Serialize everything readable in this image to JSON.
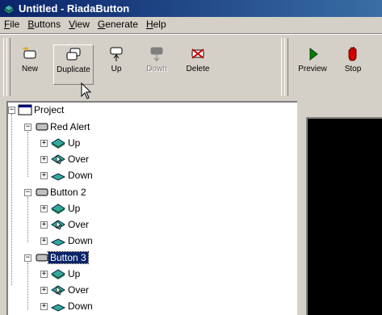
{
  "window": {
    "title": "Untitled - RiadaButton"
  },
  "menu": [
    {
      "label": "File",
      "u": "F"
    },
    {
      "label": "Buttons",
      "u": "B"
    },
    {
      "label": "View",
      "u": "V"
    },
    {
      "label": "Generate",
      "u": "G"
    },
    {
      "label": "Help",
      "u": "H"
    }
  ],
  "toolbar": {
    "new_label": "New",
    "duplicate_label": "Duplicate",
    "up_label": "Up",
    "down_label": "Down",
    "delete_label": "Delete",
    "preview_label": "Preview",
    "stop_label": "Stop"
  },
  "tree": {
    "root": "Project",
    "buttons": [
      {
        "name": "Red Alert",
        "states": [
          "Up",
          "Over",
          "Down"
        ],
        "selected": false
      },
      {
        "name": "Button 2",
        "states": [
          "Up",
          "Over",
          "Down"
        ],
        "selected": false
      },
      {
        "name": "Button 3",
        "states": [
          "Up",
          "Over",
          "Down"
        ],
        "selected": true
      }
    ]
  }
}
